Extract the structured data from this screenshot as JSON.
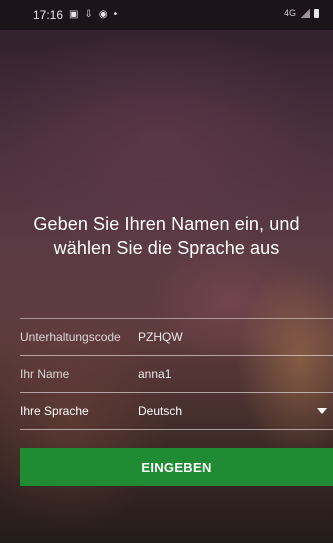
{
  "status_bar": {
    "time": "17:16",
    "icons": [
      "image-icon",
      "download-icon",
      "sync-icon",
      "dot-icon"
    ],
    "network": "4G"
  },
  "headline": {
    "line1": "Geben Sie Ihren Namen ein, und",
    "line2": "wählen Sie die Sprache aus"
  },
  "form": {
    "conversation_code": {
      "label": "Unterhaltungscode",
      "value": "PZHQW"
    },
    "name": {
      "label": "Ihr Name",
      "value": "anna1"
    },
    "language": {
      "label": "Ihre Sprache",
      "value": "Deutsch"
    }
  },
  "submit_label": "EINGEBEN",
  "colors": {
    "accent": "#1f8b33",
    "text": "#ffffff"
  }
}
